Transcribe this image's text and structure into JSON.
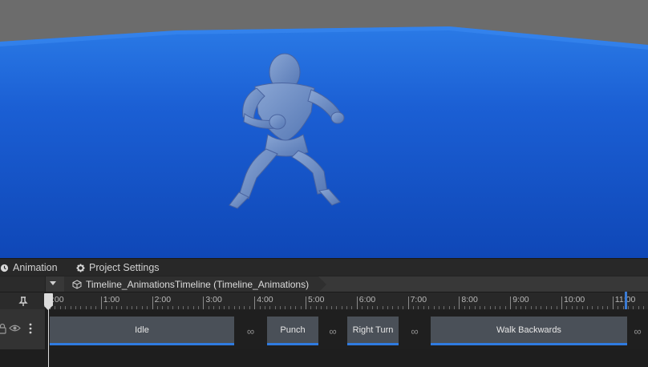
{
  "colors": {
    "floor_blue": "#1b58c8",
    "panel_bg": "#282828",
    "clip_bg": "#4a5058",
    "clip_underline": "#2f7be0",
    "playhead": "#dcdcdc",
    "character": "#6f8fc0"
  },
  "tabs": [
    {
      "label": "Animation",
      "icon": "clock-icon"
    },
    {
      "label": "Project Settings",
      "icon": "gear-icon"
    }
  ],
  "breadcrumb": {
    "icon": "cube-icon",
    "label": "Timeline_AnimationsTimeline (Timeline_Animations)"
  },
  "ruler": {
    "ticks": [
      ":00",
      "1:00",
      "2:00",
      "3:00",
      "4:00",
      "5:00",
      "6:00",
      "7:00",
      "8:00",
      "9:00",
      "10:00",
      "11:00"
    ]
  },
  "track": {
    "clips": [
      {
        "label": "Idle"
      },
      {
        "label": "Punch"
      },
      {
        "label": "Right Turn"
      },
      {
        "label": "Walk Backwards"
      }
    ],
    "blend_symbol": "∞"
  }
}
